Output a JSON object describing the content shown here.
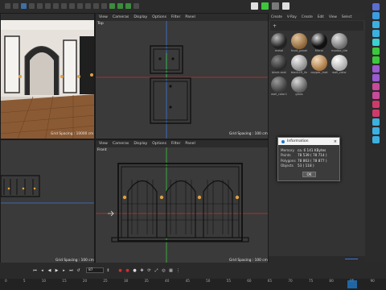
{
  "viewport_menu": [
    "View",
    "Cameras",
    "Display",
    "Options",
    "Filter",
    "Panel"
  ],
  "material_menu": [
    "Create",
    "V-Ray",
    "Create",
    "Edit",
    "View",
    "Select"
  ],
  "viewports": {
    "perspective": {
      "grid": "Grid Spacing : 10000 cm"
    },
    "top": {
      "label": "Top",
      "grid": "Grid Spacing : 100 cm"
    },
    "right": {
      "grid": "Grid Spacing : 100 cm"
    },
    "front": {
      "label": "Front",
      "grid": "Grid Spacing : 100 cm"
    }
  },
  "materials": [
    {
      "name": "metal",
      "color": "#2a2a2a"
    },
    {
      "name": "front_panel",
      "color": "#b48a5e"
    },
    {
      "name": "Mirror",
      "color": "#1a1a1a"
    },
    {
      "name": "marble_tile",
      "color": "#9a9a9a"
    },
    {
      "name": "black.mat",
      "color": "#454545"
    },
    {
      "name": "black29_lin",
      "color": "#b9b9b9"
    },
    {
      "name": "copper_mat",
      "color": "#c8a070"
    },
    {
      "name": "wall_color",
      "color": "#d4d4d4"
    },
    {
      "name": "wall_color1",
      "color": "#5a5a5a"
    },
    {
      "name": "glass",
      "color": "#8b8b8b"
    }
  ],
  "info_dialog": {
    "title": "Information",
    "rows": [
      {
        "k": "Memory",
        "v": "ca. 6 141 KBytes"
      },
      {
        "k": "Points",
        "v": "78 539 ( 78 714 )"
      },
      {
        "k": "Polygons",
        "v": "78 863 ( 78 877 )"
      },
      {
        "k": "Objects",
        "v": "53 ( 118 )"
      }
    ],
    "ok": "OK"
  },
  "timeline": {
    "frame": "87",
    "ticks": [
      "0",
      "5",
      "10",
      "15",
      "20",
      "25",
      "30",
      "35",
      "40",
      "45",
      "50",
      "55",
      "60",
      "65",
      "70",
      "75",
      "80",
      "85",
      "90"
    ]
  },
  "colors": {
    "accent": "#1e78c8",
    "record": "#d03030",
    "axis_red": "#c83232",
    "axis_blue": "#3c78dc",
    "axis_green": "#3cc83c"
  }
}
